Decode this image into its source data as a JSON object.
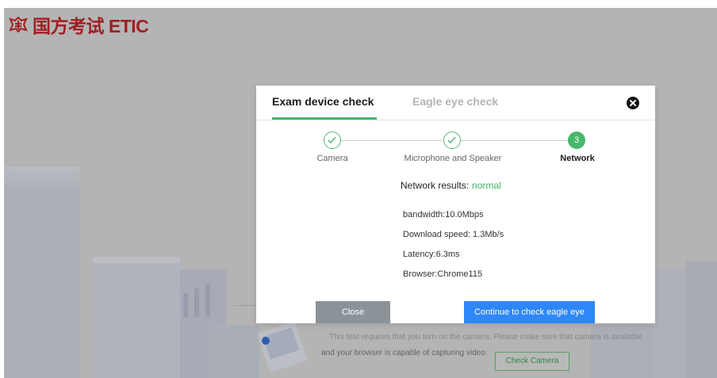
{
  "background": {
    "logo_text": "国方考试 ETIC",
    "hint_line1": "This test requires that you turn on the camera. Please make sure that camera is available",
    "hint_line2": "and your browser is capable of capturing video.",
    "check_camera_label": "Check Camera"
  },
  "modal": {
    "tabs": [
      {
        "label": "Exam device check",
        "active": true
      },
      {
        "label": "Eagle eye check",
        "active": false
      }
    ],
    "steps": [
      {
        "label": "Camera",
        "status": "done"
      },
      {
        "label": "Microphone and Speaker",
        "status": "done"
      },
      {
        "label": "Network",
        "status": "current",
        "number": "3"
      }
    ],
    "result_label": "Network results:",
    "result_value": "normal",
    "info": [
      "bandwidth:10.0Mbps",
      "Download speed: 1.3Mb/s",
      "Latency:6.3ms",
      "Browser:Chrome115"
    ],
    "close_button": "Close",
    "continue_button": "Continue to check eagle eye"
  },
  "colors": {
    "accent_green": "#47b26c",
    "primary_blue": "#2f86f6",
    "close_grey": "#8c9398",
    "logo_red": "#c3272b"
  }
}
